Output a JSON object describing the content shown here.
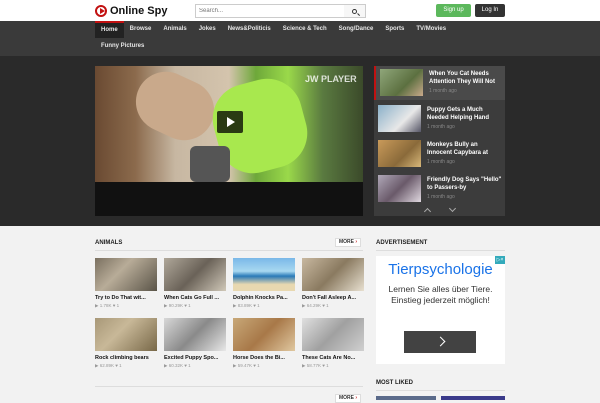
{
  "header": {
    "logo_text": "Online Spy",
    "search_placeholder": "Search...",
    "signup_label": "Sign up",
    "login_label": "Log In"
  },
  "nav": {
    "row1": [
      "Home",
      "Browse",
      "Animals",
      "Jokes",
      "News&Politicis",
      "Science & Tech",
      "Song/Dance",
      "Sports",
      "TV/Movies"
    ],
    "row2": [
      "Funny Pictures"
    ]
  },
  "player": {
    "watermark": "JW PLAYER"
  },
  "featured": [
    {
      "title": "When You Cat Needs Attention They Will Not",
      "time": "1 month ago"
    },
    {
      "title": "Puppy Gets a Much Needed Helping Hand",
      "time": "1 month ago"
    },
    {
      "title": "Monkeys Bully an Innocent Capybara at",
      "time": "1 month ago"
    },
    {
      "title": "Friendly Dog Says \"Hello\" to Passers-by",
      "time": "1 month ago"
    }
  ],
  "animals": {
    "title": "ANIMALS",
    "more_label": "MORE",
    "cards": [
      {
        "title": "Try to Do That wit...",
        "views": "1.78K",
        "likes": "1"
      },
      {
        "title": "When Cats Go Full ...",
        "views": "90.29K",
        "likes": "1"
      },
      {
        "title": "Dolphin Knocks Pa...",
        "views": "83.89K",
        "likes": "1"
      },
      {
        "title": "Don't Fall Asleep A...",
        "views": "64.29K",
        "likes": "1"
      },
      {
        "title": "Rock climbing bears",
        "views": "62.89K",
        "likes": "1"
      },
      {
        "title": "Excited Puppy Spo...",
        "views": "60.32K",
        "likes": "1"
      },
      {
        "title": "Horse Does the Bi...",
        "views": "59.47K",
        "likes": "1"
      },
      {
        "title": "These Cats Are No...",
        "views": "58.77K",
        "likes": "1"
      }
    ]
  },
  "sidebar": {
    "advertisement_title": "ADVERTISEMENT",
    "most_liked_title": "MOST LIKED"
  },
  "ad": {
    "headline": "Tierpsychologie",
    "body": "Lernen Sie alles über Tiere. Einstieg jederzeit möglich!",
    "badge": "▷×"
  },
  "colors": {
    "accent": "#c21111",
    "signup": "#5cb85c",
    "nav_bg": "#3a3a3a",
    "hero_bg": "#2a2a2a"
  }
}
